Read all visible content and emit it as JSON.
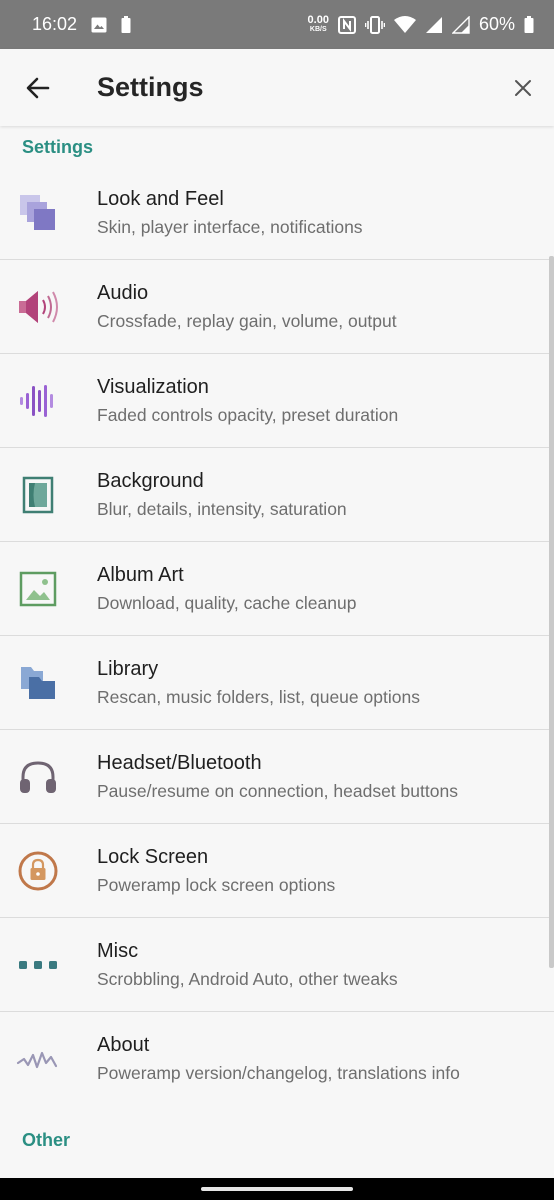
{
  "status_bar": {
    "time": "16:02",
    "net_speed_value": "0.00",
    "net_speed_unit": "KB/S",
    "battery_percent": "60%",
    "icons": [
      "image-icon",
      "battery-saver-icon",
      "nfc-icon",
      "vibrate-icon",
      "wifi-icon",
      "signal-icon",
      "signal-icon",
      "battery-icon"
    ]
  },
  "app_bar": {
    "title": "Settings",
    "back_icon": "arrow-back-icon",
    "close_icon": "close-icon"
  },
  "sections": {
    "settings_header": "Settings",
    "other_header": "Other"
  },
  "items": [
    {
      "title": "Look and Feel",
      "subtitle": "Skin, player interface, notifications",
      "icon": "layers-icon",
      "color": "#8e88c9"
    },
    {
      "title": "Audio",
      "subtitle": "Crossfade, replay gain, volume, output",
      "icon": "speaker-icon",
      "color": "#b94f7e"
    },
    {
      "title": "Visualization",
      "subtitle": "Faded controls opacity, preset duration",
      "icon": "waveform-icon",
      "color": "#8a52c4"
    },
    {
      "title": "Background",
      "subtitle": "Blur, details, intensity, saturation",
      "icon": "background-icon",
      "color": "#3f7f73"
    },
    {
      "title": "Album Art",
      "subtitle": "Download, quality, cache cleanup",
      "icon": "image-icon",
      "color": "#5e9c61"
    },
    {
      "title": "Library",
      "subtitle": "Rescan, music folders, list, queue options",
      "icon": "folders-icon",
      "color": "#4a6fa5"
    },
    {
      "title": "Headset/Bluetooth",
      "subtitle": "Pause/resume on connection, headset buttons",
      "icon": "headset-icon",
      "color": "#6f6472"
    },
    {
      "title": "Lock Screen",
      "subtitle": "Poweramp lock screen options",
      "icon": "lock-icon",
      "color": "#c0784a"
    },
    {
      "title": "Misc",
      "subtitle": "Scrobbling, Android Auto, other tweaks",
      "icon": "more-dots-icon",
      "color": "#3a7a80"
    },
    {
      "title": "About",
      "subtitle": "Poweramp version/changelog, translations info",
      "icon": "pulse-icon",
      "color": "#9a97b5"
    }
  ],
  "colors": {
    "accent": "#2b8f83",
    "background": "#f7f7f7",
    "status_bar": "#7a7a7a"
  }
}
